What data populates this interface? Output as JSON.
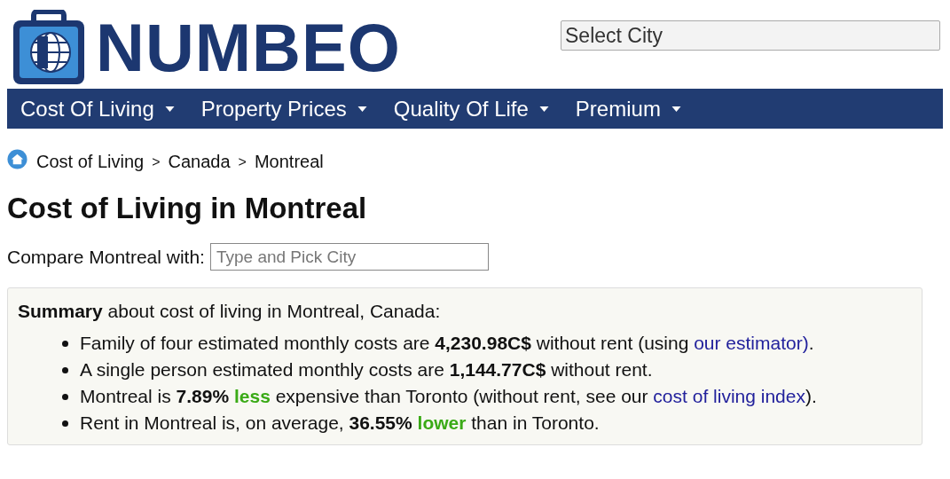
{
  "header": {
    "logo_text": "NUMBEO",
    "city_select": {
      "placeholder": "Select City"
    }
  },
  "nav": [
    {
      "label": "Cost Of Living"
    },
    {
      "label": "Property Prices"
    },
    {
      "label": "Quality Of Life"
    },
    {
      "label": "Premium"
    }
  ],
  "breadcrumb": [
    "Cost of Living",
    "Canada",
    "Montreal"
  ],
  "breadcrumb_separator": ">",
  "title": "Cost of Living in Montreal",
  "compare": {
    "label": "Compare Montreal with:",
    "placeholder": "Type and Pick City"
  },
  "summary": {
    "heading": "Summary",
    "intro": "about cost of living in Montreal, Canada:",
    "items": [
      {
        "segments": [
          {
            "kind": "plain",
            "text": "Family of four estimated monthly costs are "
          },
          {
            "kind": "bold",
            "text": "4,230.98C$"
          },
          {
            "kind": "plain",
            "text": " without rent (using "
          },
          {
            "kind": "link",
            "text": "our estimator)"
          },
          {
            "kind": "plain",
            "text": "."
          }
        ]
      },
      {
        "segments": [
          {
            "kind": "plain",
            "text": "A single person estimated monthly costs are "
          },
          {
            "kind": "bold",
            "text": "1,144.77C$"
          },
          {
            "kind": "plain",
            "text": " without rent."
          }
        ]
      },
      {
        "segments": [
          {
            "kind": "plain",
            "text": "Montreal is "
          },
          {
            "kind": "bold",
            "text": "7.89% "
          },
          {
            "kind": "good",
            "text": "less"
          },
          {
            "kind": "plain",
            "text": " expensive than Toronto (without rent, see our "
          },
          {
            "kind": "link",
            "text": "cost of living index"
          },
          {
            "kind": "plain",
            "text": ")."
          }
        ]
      },
      {
        "segments": [
          {
            "kind": "plain",
            "text": "Rent in Montreal is, on average, "
          },
          {
            "kind": "bold",
            "text": "36.55% "
          },
          {
            "kind": "good",
            "text": "lower"
          },
          {
            "kind": "plain",
            "text": " than in Toronto."
          }
        ]
      }
    ]
  }
}
